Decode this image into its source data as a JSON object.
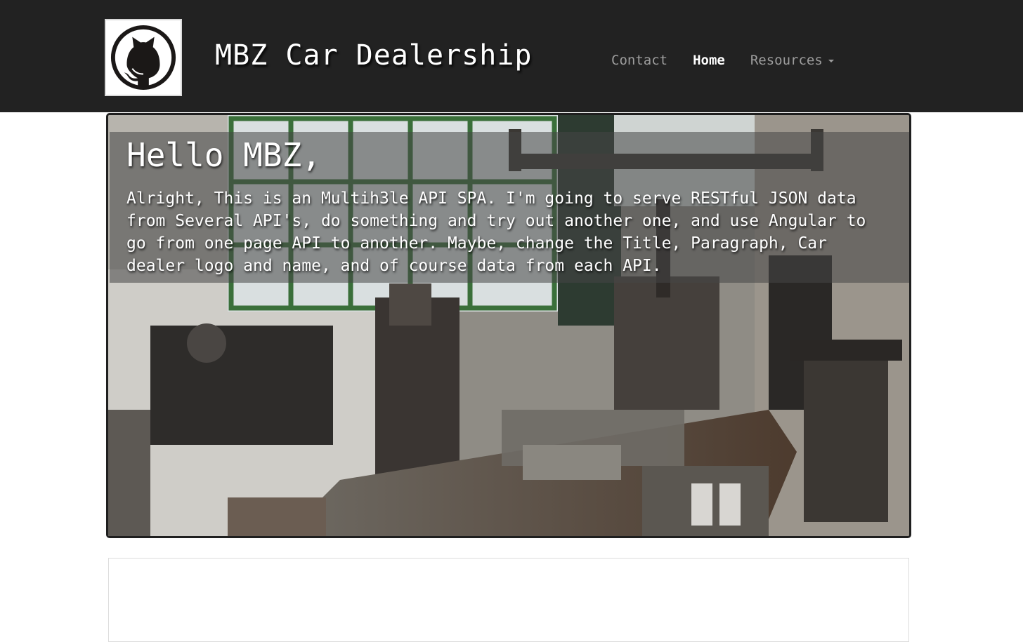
{
  "header": {
    "brand": "MBZ Car Dealership",
    "logo_icon": "github-octocat-icon",
    "nav": [
      {
        "label": "Contact",
        "active": false
      },
      {
        "label": "Home",
        "active": true
      },
      {
        "label": "Resources",
        "active": false,
        "dropdown": true
      }
    ]
  },
  "hero": {
    "title": "Hello MBZ,",
    "text": "Alright, This is an Multih3le API SPA. I'm going to serve RESTful JSON data from Several API's, do something and try out another one, and use Angular to go from one page API to another. Maybe, change the Title, Paragraph, Car dealer logo and name, and of course data from each API.",
    "background_icon": "workshop-photo"
  },
  "colors": {
    "navbar_bg": "#222222",
    "nav_inactive": "#9d9d9d",
    "nav_active": "#ffffff"
  }
}
